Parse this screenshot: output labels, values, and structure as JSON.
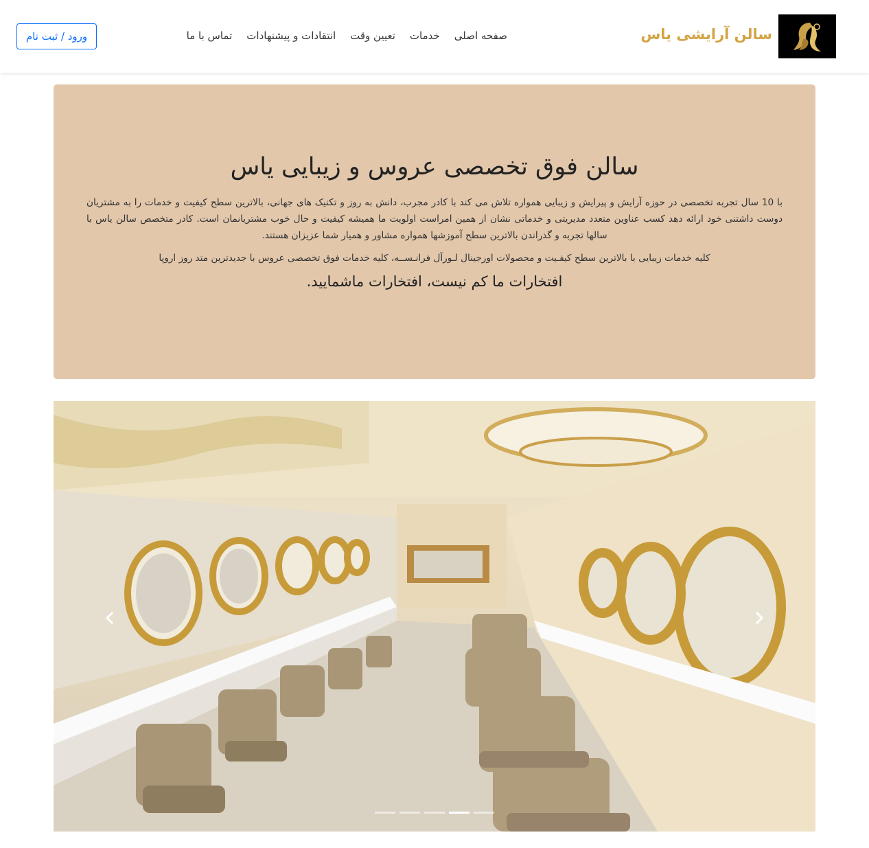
{
  "header": {
    "brand_title": "سالن آرایشی یاس",
    "logo_icon": "woman-silhouette-logo-icon",
    "nav": [
      "صفحه اصلی",
      "خدمات",
      "تعیین وقت",
      "انتقادات و پیشنهادات",
      "تماس با ما"
    ],
    "login_label": "ورود / ثبت نام"
  },
  "hero": {
    "title": "سالن فوق تخصصی عروس و زیبایی یاس",
    "paragraph": "با 10 سال تجربه تخصصی در حوزه آرایش و پیرایش و زیبایی همواره تلاش می کند با کادر مجرب، دانش به روز و تکنیک های جهانی، بالاترین سطح کیفیت و خدمات را به مشتریان دوست داشتنی خود ارائه دهد کسب عناوین متعدد مدیریتی و خدماتی نشان از همین امراست اولویت ما همیشه کیفیت و حال خوب مشتریانمان است. کادر متخصص سالن یاس با سالها تجربه و گذراندن بالاترین سطح آموزشها همواره مشاور و همیار شما عزیزان هستند.",
    "line2": "کلیه خدمات زیبایی با بالاترین سطح کیفـیت و محصولات اورجینال لـورآل فرانـســه، کلیه خدمات فوق تخصصی عروس با جدیدترین متد روز اروپا",
    "tagline": "افتخارات ما کم نیست، افتخارات ماشمایید."
  },
  "carousel": {
    "image": "salon-interior-photo",
    "prev_icon": "chevron-left-icon",
    "next_icon": "chevron-right-icon",
    "slide_count": 5,
    "active_index": 3
  }
}
